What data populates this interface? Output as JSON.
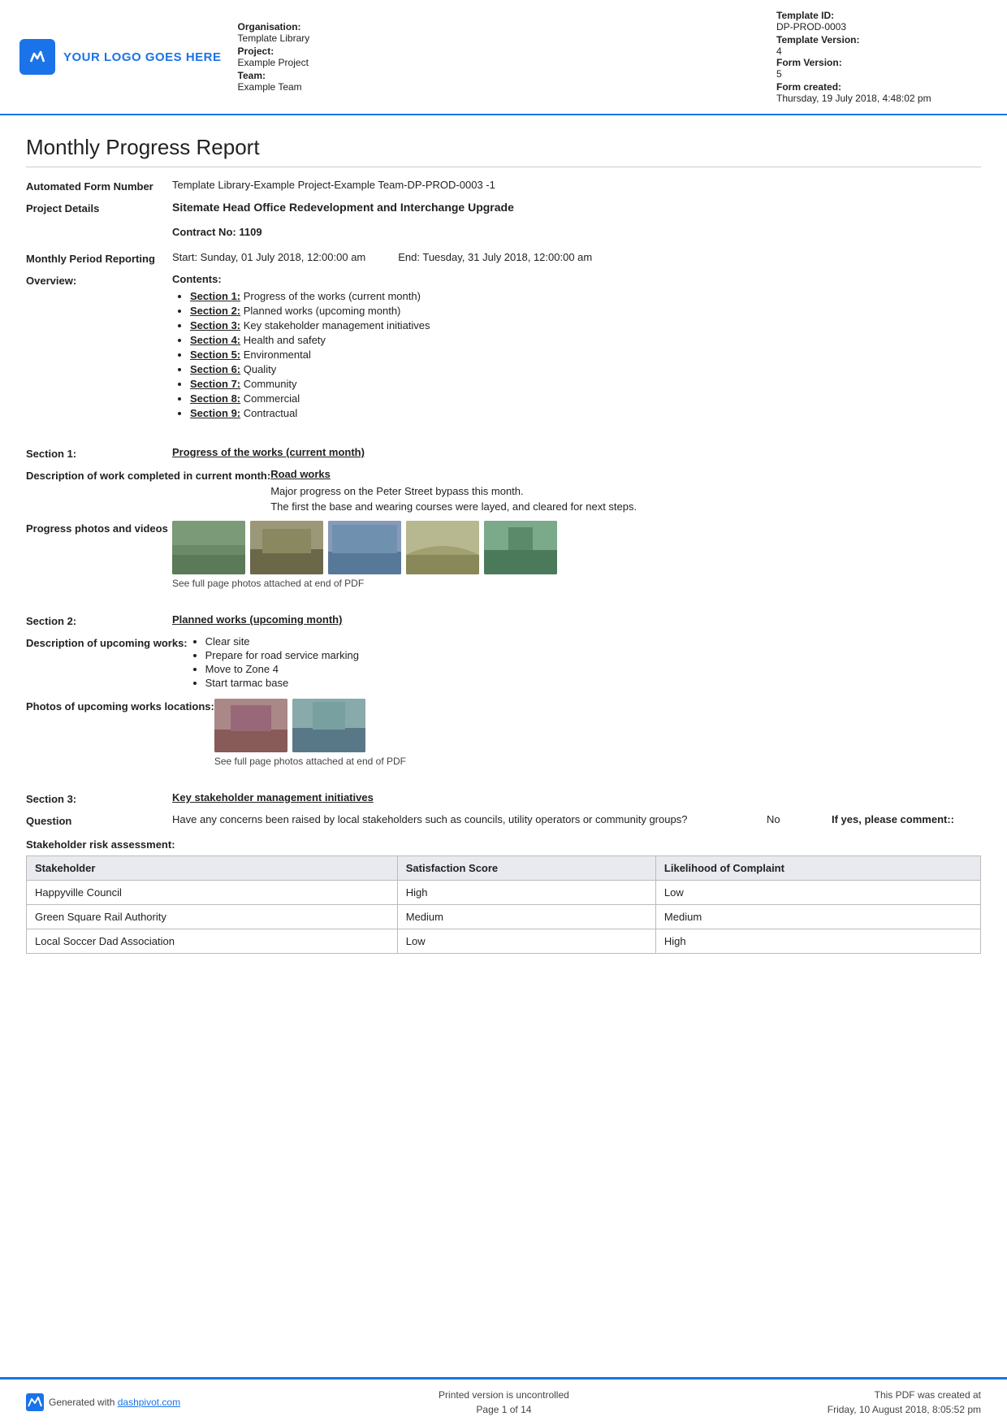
{
  "header": {
    "logo_text": "YOUR LOGO GOES HERE",
    "org_label": "Organisation:",
    "org_value": "Template Library",
    "project_label": "Project:",
    "project_value": "Example Project",
    "team_label": "Team:",
    "team_value": "Example Team",
    "template_id_label": "Template ID:",
    "template_id_value": "DP-PROD-0003",
    "template_version_label": "Template Version:",
    "template_version_value": "4",
    "form_version_label": "Form Version:",
    "form_version_value": "5",
    "form_created_label": "Form created:",
    "form_created_value": "Thursday, 19 July 2018, 4:48:02 pm"
  },
  "report": {
    "title": "Monthly Progress Report",
    "form_number_label": "Automated Form Number",
    "form_number_value": "Template Library-Example Project-Example Team-DP-PROD-0003   -1",
    "project_details_label": "Project Details",
    "project_details_value": "Sitemate Head Office Redevelopment and Interchange Upgrade",
    "contract_no_label": "Contract No:",
    "contract_no_value": "1109",
    "period_label": "Monthly Period Reporting",
    "period_start": "Start: Sunday, 01 July 2018, 12:00:00 am",
    "period_end": "End: Tuesday, 31 July 2018, 12:00:00 am",
    "overview_label": "Overview:",
    "contents_label": "Contents:",
    "contents_items": [
      {
        "link": "Section 1:",
        "text": " Progress of the works (current month)"
      },
      {
        "link": "Section 2:",
        "text": " Planned works (upcoming month)"
      },
      {
        "link": "Section 3:",
        "text": " Key stakeholder management initiatives"
      },
      {
        "link": "Section 4:",
        "text": " Health and safety"
      },
      {
        "link": "Section 5:",
        "text": " Environmental"
      },
      {
        "link": "Section 6:",
        "text": " Quality"
      },
      {
        "link": "Section 7:",
        "text": " Community"
      },
      {
        "link": "Section 8:",
        "text": " Commercial"
      },
      {
        "link": "Section 9:",
        "text": " Contractual"
      }
    ],
    "section1_label": "Section 1:",
    "section1_title": "Progress of the works (current month)",
    "desc_work_label": "Description of work completed in current month:",
    "desc_work_subtitle": "Road works",
    "desc_work_text1": "Major progress on the Peter Street bypass this month.",
    "desc_work_text2": "The first the base and wearing courses were layed, and cleared for next steps.",
    "progress_photos_label": "Progress photos and videos",
    "photo_caption": "See full page photos attached at end of PDF",
    "section2_label": "Section 2:",
    "section2_title": "Planned works (upcoming month)",
    "desc_upcoming_label": "Description of upcoming works:",
    "upcoming_works": [
      "Clear site",
      "Prepare for road service marking",
      "Move to Zone 4",
      "Start tarmac base"
    ],
    "photos_upcoming_label": "Photos of upcoming works locations:",
    "upcoming_photo_caption": "See full page photos attached at end of PDF",
    "section3_label": "Section 3:",
    "section3_title": "Key stakeholder management initiatives",
    "question_label": "Question",
    "question_text": "Have any concerns been raised by local stakeholders such as councils, utility operators or community groups?",
    "question_answer": "No",
    "question_comment_label": "If yes, please comment::",
    "stakeholder_title": "Stakeholder risk assessment:",
    "stakeholder_headers": [
      "Stakeholder",
      "Satisfaction Score",
      "Likelihood of Complaint"
    ],
    "stakeholder_rows": [
      [
        "Happyville Council",
        "High",
        "Low"
      ],
      [
        "Green Square Rail Authority",
        "Medium",
        "Medium"
      ],
      [
        "Local Soccer Dad Association",
        "Low",
        "High"
      ]
    ]
  },
  "footer": {
    "generated_text": "Generated with ",
    "generated_link": "dashpivot.com",
    "center_line1": "Printed version is uncontrolled",
    "center_line2": "Page 1 of 14",
    "right_line1": "This PDF was created at",
    "right_line2": "Friday, 10 August 2018, 8:05:52 pm"
  }
}
